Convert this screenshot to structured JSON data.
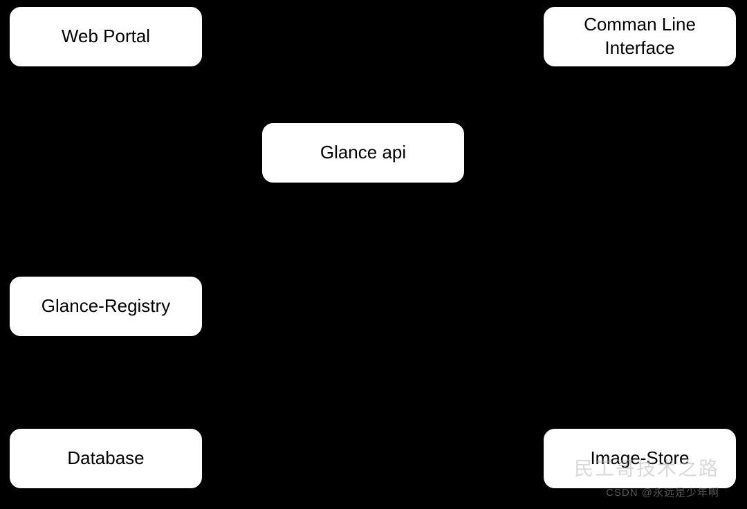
{
  "diagram": {
    "nodes": {
      "web_portal": {
        "label": "Web Portal"
      },
      "cli": {
        "label": "Comman Line Interface"
      },
      "glance_api": {
        "label": "Glance api"
      },
      "glance_registry": {
        "label": "Glance-Registry"
      },
      "database": {
        "label": "Database"
      },
      "image_store": {
        "label": "Image-Store"
      }
    },
    "edges": [
      {
        "from": "web_portal",
        "to": "glance_api"
      },
      {
        "from": "cli",
        "to": "glance_api"
      },
      {
        "from": "glance_api",
        "to": "glance_registry"
      },
      {
        "from": "glance_api",
        "to": "image_store"
      },
      {
        "from": "glance_registry",
        "to": "database"
      }
    ]
  },
  "watermarks": {
    "primary": "民工哥技术之路",
    "secondary": "CSDN @永远是少年啊"
  }
}
